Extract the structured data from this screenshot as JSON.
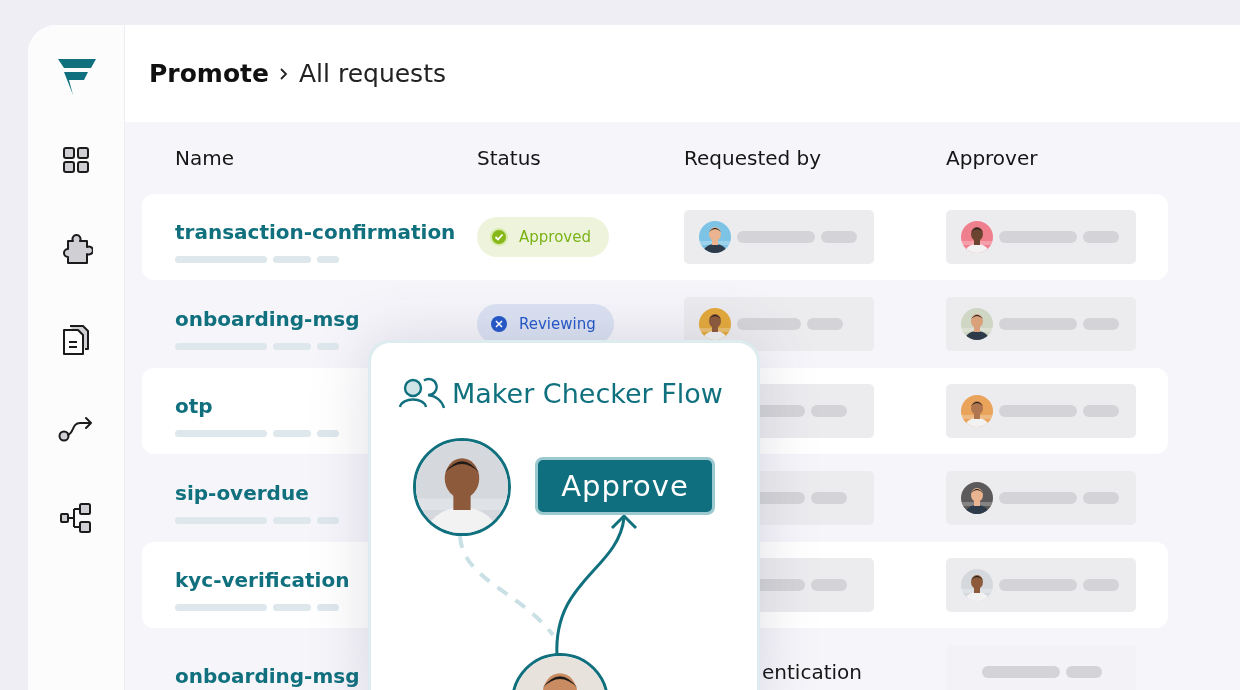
{
  "breadcrumb": {
    "section": "Promote",
    "page": "All requests"
  },
  "columns": [
    "Name",
    "Status",
    "Requested by",
    "Approver"
  ],
  "rows": [
    {
      "name": "transaction-confirmation",
      "status": {
        "kind": "approved",
        "label": "Approved"
      },
      "requester": {
        "avatar": true
      },
      "approver": {
        "avatar": true
      }
    },
    {
      "name": "onboarding-msg",
      "status": {
        "kind": "reviewing",
        "label": "Reviewing"
      },
      "requester": {
        "avatar": true
      },
      "approver": {
        "avatar": true
      }
    },
    {
      "name": "otp",
      "requester": {
        "avatar": false
      },
      "approver": {
        "avatar": true
      }
    },
    {
      "name": "sip-overdue",
      "requester": {
        "avatar": false
      },
      "approver": {
        "avatar": true
      }
    },
    {
      "name": "kyc-verification",
      "requester": {
        "avatar": false
      },
      "approver": {
        "avatar": true
      }
    },
    {
      "name": "onboarding-msg",
      "requester": {
        "text": "entication"
      },
      "approver": {
        "avatar": false
      }
    }
  ],
  "popup": {
    "title": "Maker Checker Flow",
    "button": "Approve"
  }
}
